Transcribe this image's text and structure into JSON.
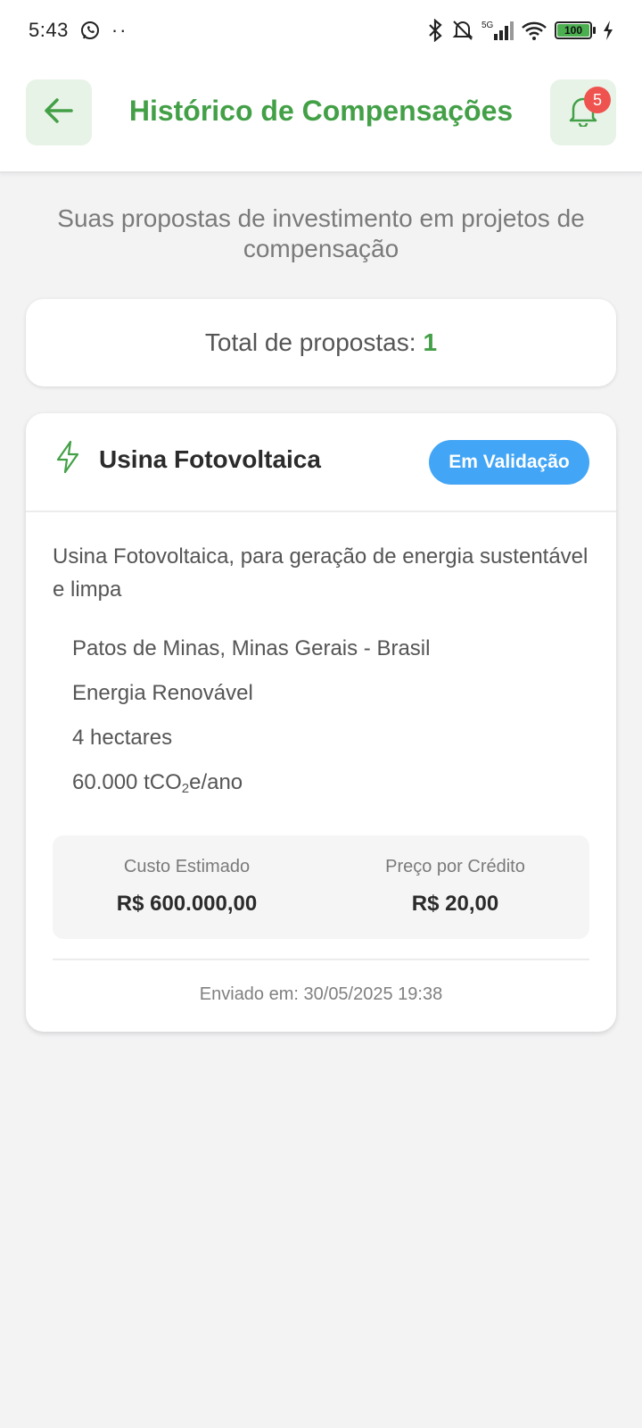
{
  "status_bar": {
    "time": "5:43",
    "dots": "··",
    "network": "5G",
    "battery": "100"
  },
  "header": {
    "title": "Histórico de Compensações",
    "notification_count": "5"
  },
  "subtitle": "Suas propostas de investimento em projetos de compensação",
  "total": {
    "label": "Total de propostas:",
    "count": "1"
  },
  "proposal": {
    "title": "Usina Fotovoltaica",
    "status": "Em Validação",
    "description": "Usina Fotovoltaica, para geração de energia sustentável e limpa",
    "location": "Patos de Minas, Minas Gerais  - Brasil",
    "category": "Energia Renovável",
    "area": "4 hectares",
    "emissions_prefix": "60.000 tCO",
    "emissions_sub": "2",
    "emissions_suffix": "e/ano",
    "cost_label": "Custo Estimado",
    "cost_value": "R$ 600.000,00",
    "price_label": "Preço por Crédito",
    "price_value": "R$ 20,00",
    "sent_at": "Enviado em: 30/05/2025 19:38"
  },
  "colors": {
    "primary": "#43a047",
    "status_blue": "#42a5f5",
    "badge_red": "#ef5350"
  },
  "icons": [
    "back-arrow-icon",
    "bell-icon",
    "lightning-icon",
    "whatsapp-icon",
    "bluetooth-icon",
    "silent-bell-icon",
    "signal-icon",
    "wifi-icon",
    "battery-icon",
    "charging-icon"
  ]
}
